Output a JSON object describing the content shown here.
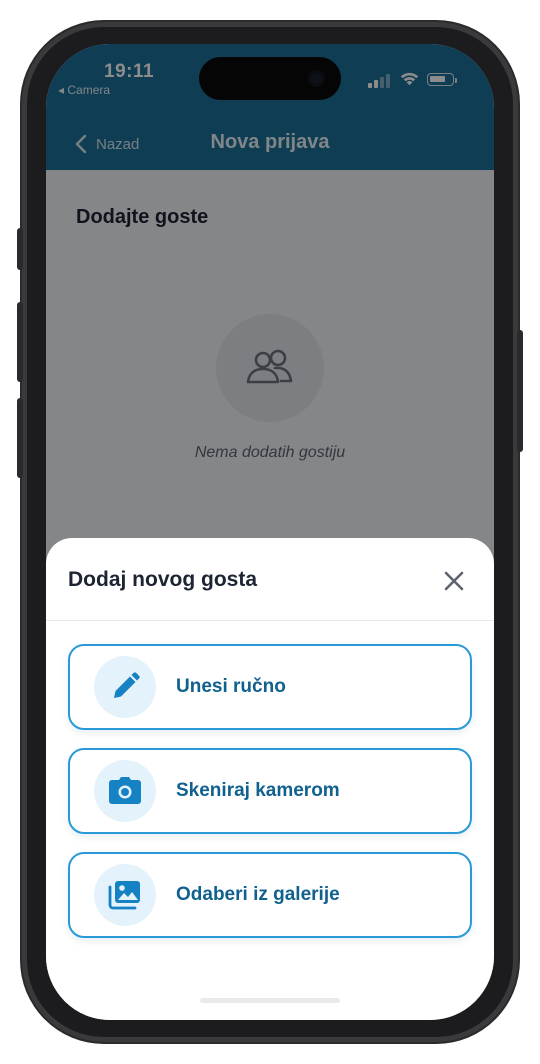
{
  "status_bar": {
    "time": "19:11",
    "back_app": "◂ Camera"
  },
  "nav": {
    "back_label": "Nazad",
    "title": "Nova prijava"
  },
  "content": {
    "section_title": "Dodajte goste",
    "empty_text": "Nema dodatih gostiju"
  },
  "sheet": {
    "title": "Dodaj novog gosta",
    "options": [
      {
        "label": "Unesi ručno",
        "icon": "pencil-icon"
      },
      {
        "label": "Skeniraj kamerom",
        "icon": "camera-icon"
      },
      {
        "label": "Odaberi iz galerije",
        "icon": "gallery-icon"
      }
    ]
  },
  "colors": {
    "header": "#1a6f99",
    "accent": "#2a9ad6",
    "option_text": "#11618f",
    "icon_bg": "#e4f2fb"
  }
}
